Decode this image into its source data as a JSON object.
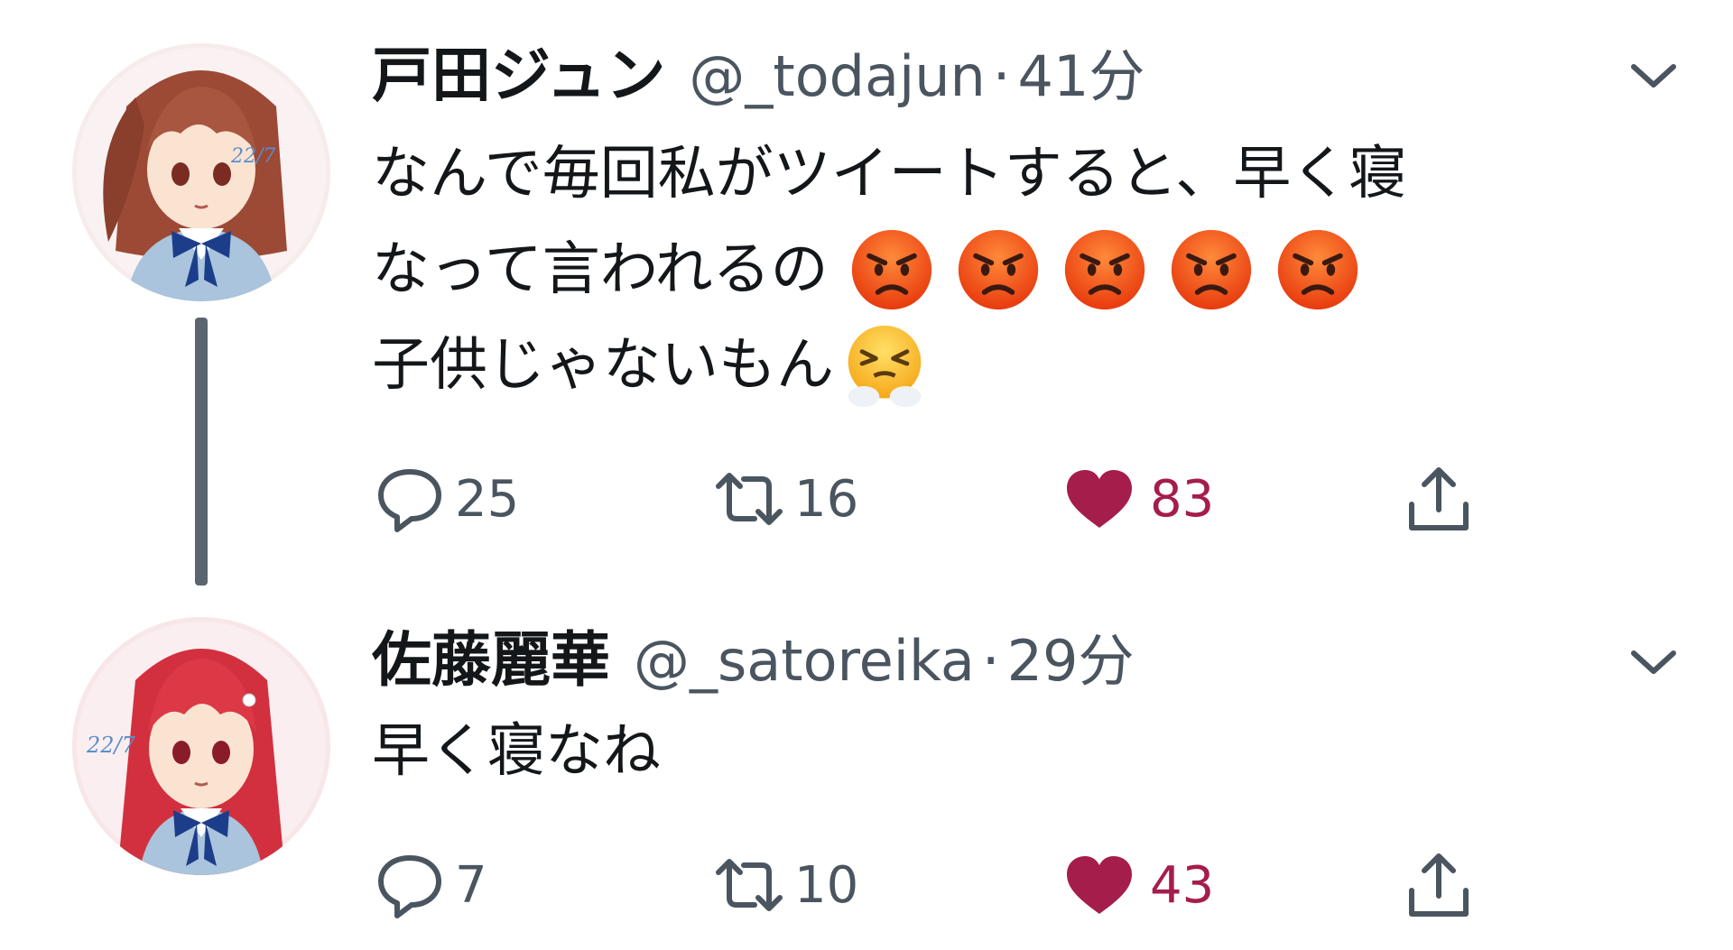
{
  "colors": {
    "text": "#14171a",
    "secondary": "#4a5560",
    "like": "#a51d4a",
    "thread_line": "#5a6570"
  },
  "tweets": [
    {
      "name": "戸田ジュン",
      "handle": "@_todajun",
      "separator": "·",
      "time": "41分",
      "lines": [
        "なんで毎回私がツイートすると、早く寝",
        "なって言われるの",
        "子供じゃないもん"
      ],
      "line2_emojis": [
        "pouting-face",
        "pouting-face",
        "pouting-face",
        "pouting-face",
        "pouting-face"
      ],
      "line3_emoji": "face-with-steam-from-nose",
      "replies": "25",
      "retweets": "16",
      "likes": "83",
      "liked": true
    },
    {
      "name": "佐藤麗華",
      "handle": "@_satoreika",
      "separator": "·",
      "time": "29分",
      "lines": [
        "早く寝なね"
      ],
      "replies": "7",
      "retweets": "10",
      "likes": "43",
      "liked": true
    }
  ],
  "icons": {
    "reply": "reply-bubble-icon",
    "retweet": "retweet-icon",
    "like": "heart-icon",
    "share": "share-icon",
    "menu": "chevron-down-icon"
  }
}
